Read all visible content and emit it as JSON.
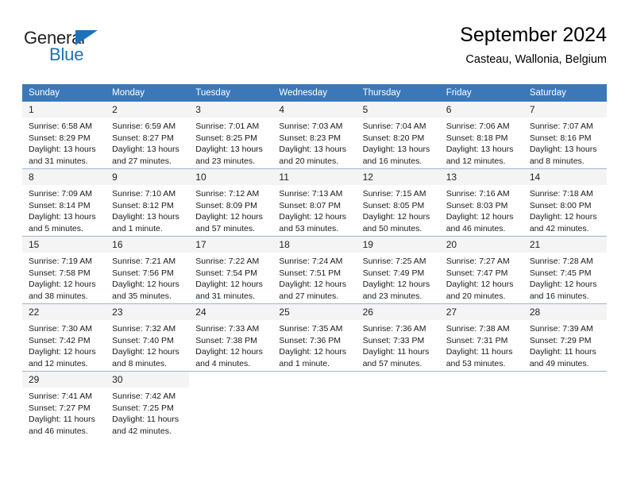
{
  "brand": {
    "name_top": "General",
    "name_bottom": "Blue",
    "color_dark": "#231f20",
    "color_blue": "#1b72b8"
  },
  "header": {
    "title": "September 2024",
    "location": "Casteau, Wallonia, Belgium"
  },
  "theme": {
    "header_bg": "#3a78ba",
    "header_text": "#ffffff",
    "daynum_bg": "#f4f4f4",
    "grid_line": "#9bb7d4",
    "body_bg": "#ffffff"
  },
  "weekday_headers": [
    "Sunday",
    "Monday",
    "Tuesday",
    "Wednesday",
    "Thursday",
    "Friday",
    "Saturday"
  ],
  "labels": {
    "sunrise_prefix": "Sunrise:",
    "sunset_prefix": "Sunset:",
    "daylight_prefix": "Daylight:"
  },
  "weeks": [
    [
      {
        "day": "1",
        "sunrise": "Sunrise: 6:58 AM",
        "sunset": "Sunset: 8:29 PM",
        "daylight_1": "Daylight: 13 hours",
        "daylight_2": "and 31 minutes."
      },
      {
        "day": "2",
        "sunrise": "Sunrise: 6:59 AM",
        "sunset": "Sunset: 8:27 PM",
        "daylight_1": "Daylight: 13 hours",
        "daylight_2": "and 27 minutes."
      },
      {
        "day": "3",
        "sunrise": "Sunrise: 7:01 AM",
        "sunset": "Sunset: 8:25 PM",
        "daylight_1": "Daylight: 13 hours",
        "daylight_2": "and 23 minutes."
      },
      {
        "day": "4",
        "sunrise": "Sunrise: 7:03 AM",
        "sunset": "Sunset: 8:23 PM",
        "daylight_1": "Daylight: 13 hours",
        "daylight_2": "and 20 minutes."
      },
      {
        "day": "5",
        "sunrise": "Sunrise: 7:04 AM",
        "sunset": "Sunset: 8:20 PM",
        "daylight_1": "Daylight: 13 hours",
        "daylight_2": "and 16 minutes."
      },
      {
        "day": "6",
        "sunrise": "Sunrise: 7:06 AM",
        "sunset": "Sunset: 8:18 PM",
        "daylight_1": "Daylight: 13 hours",
        "daylight_2": "and 12 minutes."
      },
      {
        "day": "7",
        "sunrise": "Sunrise: 7:07 AM",
        "sunset": "Sunset: 8:16 PM",
        "daylight_1": "Daylight: 13 hours",
        "daylight_2": "and 8 minutes."
      }
    ],
    [
      {
        "day": "8",
        "sunrise": "Sunrise: 7:09 AM",
        "sunset": "Sunset: 8:14 PM",
        "daylight_1": "Daylight: 13 hours",
        "daylight_2": "and 5 minutes."
      },
      {
        "day": "9",
        "sunrise": "Sunrise: 7:10 AM",
        "sunset": "Sunset: 8:12 PM",
        "daylight_1": "Daylight: 13 hours",
        "daylight_2": "and 1 minute."
      },
      {
        "day": "10",
        "sunrise": "Sunrise: 7:12 AM",
        "sunset": "Sunset: 8:09 PM",
        "daylight_1": "Daylight: 12 hours",
        "daylight_2": "and 57 minutes."
      },
      {
        "day": "11",
        "sunrise": "Sunrise: 7:13 AM",
        "sunset": "Sunset: 8:07 PM",
        "daylight_1": "Daylight: 12 hours",
        "daylight_2": "and 53 minutes."
      },
      {
        "day": "12",
        "sunrise": "Sunrise: 7:15 AM",
        "sunset": "Sunset: 8:05 PM",
        "daylight_1": "Daylight: 12 hours",
        "daylight_2": "and 50 minutes."
      },
      {
        "day": "13",
        "sunrise": "Sunrise: 7:16 AM",
        "sunset": "Sunset: 8:03 PM",
        "daylight_1": "Daylight: 12 hours",
        "daylight_2": "and 46 minutes."
      },
      {
        "day": "14",
        "sunrise": "Sunrise: 7:18 AM",
        "sunset": "Sunset: 8:00 PM",
        "daylight_1": "Daylight: 12 hours",
        "daylight_2": "and 42 minutes."
      }
    ],
    [
      {
        "day": "15",
        "sunrise": "Sunrise: 7:19 AM",
        "sunset": "Sunset: 7:58 PM",
        "daylight_1": "Daylight: 12 hours",
        "daylight_2": "and 38 minutes."
      },
      {
        "day": "16",
        "sunrise": "Sunrise: 7:21 AM",
        "sunset": "Sunset: 7:56 PM",
        "daylight_1": "Daylight: 12 hours",
        "daylight_2": "and 35 minutes."
      },
      {
        "day": "17",
        "sunrise": "Sunrise: 7:22 AM",
        "sunset": "Sunset: 7:54 PM",
        "daylight_1": "Daylight: 12 hours",
        "daylight_2": "and 31 minutes."
      },
      {
        "day": "18",
        "sunrise": "Sunrise: 7:24 AM",
        "sunset": "Sunset: 7:51 PM",
        "daylight_1": "Daylight: 12 hours",
        "daylight_2": "and 27 minutes."
      },
      {
        "day": "19",
        "sunrise": "Sunrise: 7:25 AM",
        "sunset": "Sunset: 7:49 PM",
        "daylight_1": "Daylight: 12 hours",
        "daylight_2": "and 23 minutes."
      },
      {
        "day": "20",
        "sunrise": "Sunrise: 7:27 AM",
        "sunset": "Sunset: 7:47 PM",
        "daylight_1": "Daylight: 12 hours",
        "daylight_2": "and 20 minutes."
      },
      {
        "day": "21",
        "sunrise": "Sunrise: 7:28 AM",
        "sunset": "Sunset: 7:45 PM",
        "daylight_1": "Daylight: 12 hours",
        "daylight_2": "and 16 minutes."
      }
    ],
    [
      {
        "day": "22",
        "sunrise": "Sunrise: 7:30 AM",
        "sunset": "Sunset: 7:42 PM",
        "daylight_1": "Daylight: 12 hours",
        "daylight_2": "and 12 minutes."
      },
      {
        "day": "23",
        "sunrise": "Sunrise: 7:32 AM",
        "sunset": "Sunset: 7:40 PM",
        "daylight_1": "Daylight: 12 hours",
        "daylight_2": "and 8 minutes."
      },
      {
        "day": "24",
        "sunrise": "Sunrise: 7:33 AM",
        "sunset": "Sunset: 7:38 PM",
        "daylight_1": "Daylight: 12 hours",
        "daylight_2": "and 4 minutes."
      },
      {
        "day": "25",
        "sunrise": "Sunrise: 7:35 AM",
        "sunset": "Sunset: 7:36 PM",
        "daylight_1": "Daylight: 12 hours",
        "daylight_2": "and 1 minute."
      },
      {
        "day": "26",
        "sunrise": "Sunrise: 7:36 AM",
        "sunset": "Sunset: 7:33 PM",
        "daylight_1": "Daylight: 11 hours",
        "daylight_2": "and 57 minutes."
      },
      {
        "day": "27",
        "sunrise": "Sunrise: 7:38 AM",
        "sunset": "Sunset: 7:31 PM",
        "daylight_1": "Daylight: 11 hours",
        "daylight_2": "and 53 minutes."
      },
      {
        "day": "28",
        "sunrise": "Sunrise: 7:39 AM",
        "sunset": "Sunset: 7:29 PM",
        "daylight_1": "Daylight: 11 hours",
        "daylight_2": "and 49 minutes."
      }
    ],
    [
      {
        "day": "29",
        "sunrise": "Sunrise: 7:41 AM",
        "sunset": "Sunset: 7:27 PM",
        "daylight_1": "Daylight: 11 hours",
        "daylight_2": "and 46 minutes."
      },
      {
        "day": "30",
        "sunrise": "Sunrise: 7:42 AM",
        "sunset": "Sunset: 7:25 PM",
        "daylight_1": "Daylight: 11 hours",
        "daylight_2": "and 42 minutes."
      },
      {
        "day": "",
        "sunrise": "",
        "sunset": "",
        "daylight_1": "",
        "daylight_2": ""
      },
      {
        "day": "",
        "sunrise": "",
        "sunset": "",
        "daylight_1": "",
        "daylight_2": ""
      },
      {
        "day": "",
        "sunrise": "",
        "sunset": "",
        "daylight_1": "",
        "daylight_2": ""
      },
      {
        "day": "",
        "sunrise": "",
        "sunset": "",
        "daylight_1": "",
        "daylight_2": ""
      },
      {
        "day": "",
        "sunrise": "",
        "sunset": "",
        "daylight_1": "",
        "daylight_2": ""
      }
    ]
  ]
}
